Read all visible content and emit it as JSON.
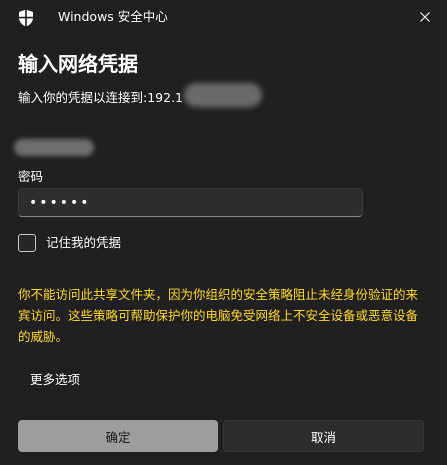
{
  "window": {
    "app_title": "Windows 安全中心",
    "app_icon": "shield-icon",
    "close_icon": "close-icon"
  },
  "dialog": {
    "heading": "输入网络凭据",
    "subtitle_prefix": "输入你的凭据以连接到:192.1",
    "password_label": "密码",
    "password_value": "••••••",
    "remember_label": "记住我的凭据",
    "remember_checked": false,
    "warning": "你不能访问此共享文件夹，因为你组织的安全策略阻止未经身份验证的来宾访问。这些策略可帮助保护你的电脑免受网络上不安全设备或恶意设备的威胁。",
    "more_options": "更多选项"
  },
  "buttons": {
    "ok_label": "确定",
    "cancel_label": "取消"
  },
  "colors": {
    "background": "#202020",
    "warning_text": "#ffd92e",
    "ok_button": "#9e9e9e",
    "cancel_button": "#2d2d2d"
  }
}
